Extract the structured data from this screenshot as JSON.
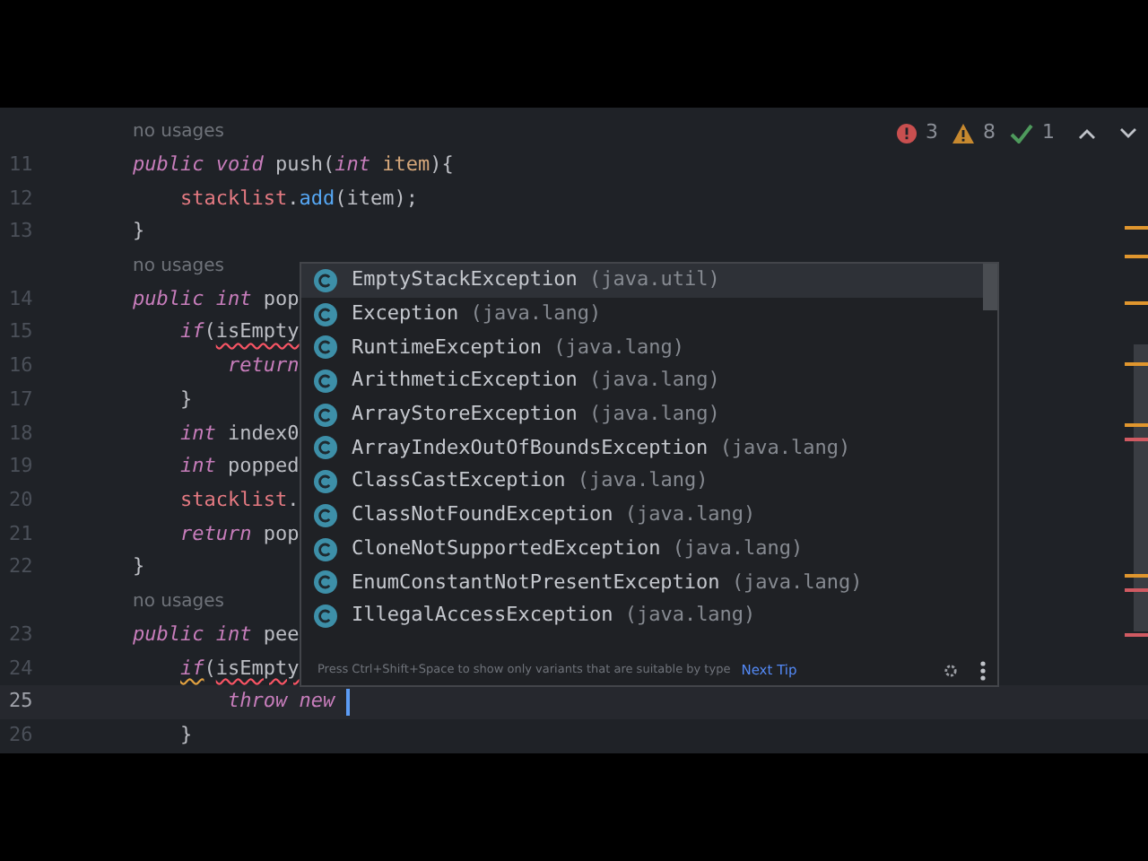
{
  "status": {
    "errors": "3",
    "warnings": "8",
    "checks": "1"
  },
  "code_lines": [
    {
      "kind": "hint",
      "text": "no usages"
    },
    {
      "kind": "code",
      "number": "11",
      "current": false,
      "tokens": [
        {
          "t": "public void ",
          "kind": "kw"
        },
        {
          "t": "push(",
          "kind": "plain"
        },
        {
          "t": "int ",
          "kind": "kw"
        },
        {
          "t": "item",
          "kind": "param"
        },
        {
          "t": "){",
          "kind": "plain"
        }
      ]
    },
    {
      "kind": "code",
      "number": "12",
      "current": false,
      "tokens": [
        {
          "t": "    stacklist",
          "kind": "field"
        },
        {
          "t": ".",
          "kind": "plain"
        },
        {
          "t": "add",
          "kind": "method"
        },
        {
          "t": "(item);",
          "kind": "plain"
        }
      ]
    },
    {
      "kind": "code",
      "number": "13",
      "current": false,
      "tokens": [
        {
          "t": "}",
          "kind": "plain"
        }
      ]
    },
    {
      "kind": "hint",
      "text": "no usages"
    },
    {
      "kind": "code",
      "number": "14",
      "current": false,
      "tokens": [
        {
          "t": "public int ",
          "kind": "kw"
        },
        {
          "t": "pop",
          "kind": "plain"
        }
      ]
    },
    {
      "kind": "code",
      "number": "15",
      "current": false,
      "tokens": [
        {
          "t": "    if",
          "kind": "kw"
        },
        {
          "t": "(",
          "kind": "plain"
        },
        {
          "t": "isEmpty",
          "kind": "plain_error"
        }
      ]
    },
    {
      "kind": "code",
      "number": "16",
      "current": false,
      "tokens": [
        {
          "t": "        return",
          "kind": "kw"
        }
      ]
    },
    {
      "kind": "code",
      "number": "17",
      "current": false,
      "tokens": [
        {
          "t": "    }",
          "kind": "plain"
        }
      ]
    },
    {
      "kind": "code",
      "number": "18",
      "current": false,
      "tokens": [
        {
          "t": "    int ",
          "kind": "kw"
        },
        {
          "t": "index0",
          "kind": "plain"
        }
      ]
    },
    {
      "kind": "code",
      "number": "19",
      "current": false,
      "tokens": [
        {
          "t": "    int ",
          "kind": "kw"
        },
        {
          "t": "popped",
          "kind": "plain"
        }
      ]
    },
    {
      "kind": "code",
      "number": "20",
      "current": false,
      "tokens": [
        {
          "t": "    stacklist",
          "kind": "field"
        },
        {
          "t": ".",
          "kind": "plain"
        }
      ]
    },
    {
      "kind": "code",
      "number": "21",
      "current": false,
      "tokens": [
        {
          "t": "    return ",
          "kind": "kw"
        },
        {
          "t": "pop",
          "kind": "plain"
        }
      ]
    },
    {
      "kind": "code",
      "number": "22",
      "current": false,
      "tokens": [
        {
          "t": "}",
          "kind": "plain"
        }
      ]
    },
    {
      "kind": "hint",
      "text": "no usages"
    },
    {
      "kind": "code",
      "number": "23",
      "current": false,
      "tokens": [
        {
          "t": "public int ",
          "kind": "kw"
        },
        {
          "t": "pee",
          "kind": "plain"
        }
      ]
    },
    {
      "kind": "code",
      "number": "24",
      "current": false,
      "tokens": [
        {
          "t": "    if",
          "kind": "kw_warning"
        },
        {
          "t": "(",
          "kind": "plain"
        },
        {
          "t": "isEmpty",
          "kind": "plain_error"
        }
      ]
    },
    {
      "kind": "code",
      "number": "25",
      "current": true,
      "tokens": [
        {
          "t": "        throw new ",
          "kind": "kw"
        }
      ]
    },
    {
      "kind": "code",
      "number": "26",
      "current": false,
      "tokens": [
        {
          "t": "    }",
          "kind": "plain"
        }
      ]
    }
  ],
  "completion": {
    "items": [
      {
        "name": "EmptyStackException",
        "package": "(java.util)",
        "selected": true
      },
      {
        "name": "Exception",
        "package": "(java.lang)",
        "selected": false
      },
      {
        "name": "RuntimeException",
        "package": "(java.lang)",
        "selected": false
      },
      {
        "name": "ArithmeticException",
        "package": "(java.lang)",
        "selected": false
      },
      {
        "name": "ArrayStoreException",
        "package": "(java.lang)",
        "selected": false
      },
      {
        "name": "ArrayIndexOutOfBoundsException",
        "package": "(java.lang)",
        "selected": false
      },
      {
        "name": "ClassCastException",
        "package": "(java.lang)",
        "selected": false
      },
      {
        "name": "ClassNotFoundException",
        "package": "(java.lang)",
        "selected": false
      },
      {
        "name": "CloneNotSupportedException",
        "package": "(java.lang)",
        "selected": false
      },
      {
        "name": "EnumConstantNotPresentException",
        "package": "(java.lang)",
        "selected": false
      },
      {
        "name": "IllegalAccessException",
        "package": "(java.lang)",
        "selected": false
      }
    ],
    "tip": "Press Ctrl+Shift+Space to show only variants that are suitable by type",
    "tip_link": "Next Tip"
  }
}
